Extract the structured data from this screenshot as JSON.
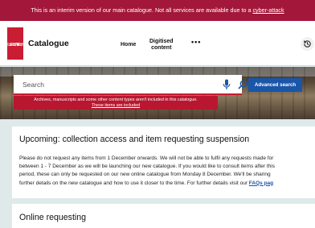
{
  "banner": {
    "text": "This is an interim version of our main catalogue. Not all services are available due to a ",
    "link": "cyber-attack"
  },
  "header": {
    "logo_lines": [
      "BRITISH",
      "LIBRARY"
    ],
    "brand": "Catalogue",
    "nav": [
      {
        "label": "Home"
      },
      {
        "label_line1": "Digitised",
        "label_line2": "content"
      },
      {
        "label": "•••"
      }
    ],
    "history_icon": "history-clock-icon"
  },
  "search": {
    "placeholder": "Search",
    "advanced_label": "Advanced search",
    "note_line1": "Archives, manuscripts and some other content types aren't included in this catalogue.",
    "note_link": "These items are included"
  },
  "cards": [
    {
      "title": "Upcoming: collection access and item requesting suspension",
      "lines": [
        "Please do not request any items from 1 December onwards. We will not be able to fulfil any requests made for",
        "between 1 - 7 December as we will be launching our new catalogue. If you would like to consult items after this",
        "period, these can only be requested on our new online catalogue from Monday 8 December. We'll be sharing",
        "further details on the new catalogue and how to use it closer to the time. For further details visit our "
      ],
      "link": "FAQs pag"
    },
    {
      "title": "Online requesting"
    }
  ],
  "colors": {
    "banner": "#a3173a",
    "accent_red": "#c81d33",
    "button_blue": "#1a56a8",
    "page_bg": "#dfe9ea"
  }
}
